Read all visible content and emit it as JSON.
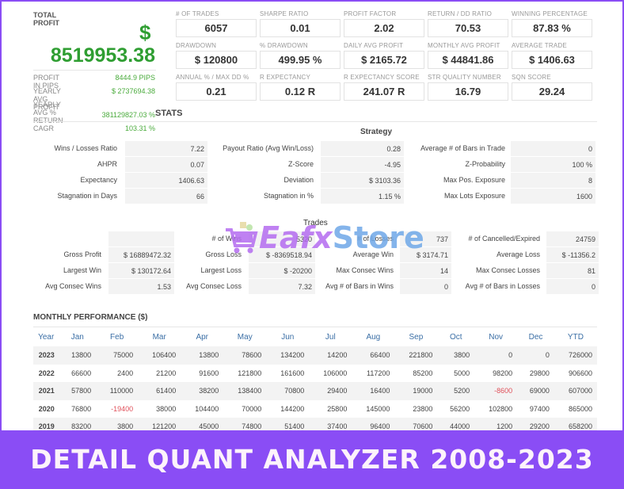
{
  "total_profit": {
    "label": "TOTAL PROFIT",
    "currency": "$",
    "value": "8519953.38"
  },
  "left_stats": [
    {
      "label": "PROFIT IN PIPS",
      "value": "8444.9 PIPS"
    },
    {
      "label": "YEARLY AVG PROFIT",
      "value": "$ 2737694.38"
    },
    {
      "label": "YEARLY AVG % RETURN",
      "value": "381129827.03 %"
    },
    {
      "label": "CAGR",
      "value": "103.31 %"
    }
  ],
  "metrics": [
    [
      {
        "label": "# OF TRADES",
        "value": "6057"
      },
      {
        "label": "SHARPE RATIO",
        "value": "0.01"
      },
      {
        "label": "PROFIT FACTOR",
        "value": "2.02"
      },
      {
        "label": "RETURN / DD RATIO",
        "value": "70.53"
      },
      {
        "label": "WINNING PERCENTAGE",
        "value": "87.83 %"
      }
    ],
    [
      {
        "label": "DRAWDOWN",
        "value": "$ 120800"
      },
      {
        "label": "% DRAWDOWN",
        "value": "499.95 %"
      },
      {
        "label": "DAILY AVG PROFIT",
        "value": "$ 2165.72"
      },
      {
        "label": "MONTHLY AVG PROFIT",
        "value": "$ 44841.86"
      },
      {
        "label": "AVERAGE TRADE",
        "value": "$ 1406.63"
      }
    ],
    [
      {
        "label": "ANNUAL % / MAX DD %",
        "value": "0.21"
      },
      {
        "label": "R EXPECTANCY",
        "value": "0.12 R"
      },
      {
        "label": "R EXPECTANCY SCORE",
        "value": "241.07 R"
      },
      {
        "label": "STR QUALITY NUMBER",
        "value": "16.79"
      },
      {
        "label": "SQN SCORE",
        "value": "29.24"
      }
    ]
  ],
  "stats_title": "STATS",
  "strategy": {
    "title": "Strategy",
    "rows": [
      [
        {
          "label": "Wins / Losses Ratio",
          "value": "7.22"
        },
        {
          "label": "Payout Ratio (Avg Win/Loss)",
          "value": "0.28"
        },
        {
          "label": "Average # of Bars in Trade",
          "value": "0"
        }
      ],
      [
        {
          "label": "AHPR",
          "value": "0.07"
        },
        {
          "label": "Z-Score",
          "value": "-4.95"
        },
        {
          "label": "Z-Probability",
          "value": "100 %"
        }
      ],
      [
        {
          "label": "Expectancy",
          "value": "1406.63"
        },
        {
          "label": "Deviation",
          "value": "$ 3103.36"
        },
        {
          "label": "Max Pos. Exposure",
          "value": "8"
        }
      ],
      [
        {
          "label": "Stagnation in Days",
          "value": "66"
        },
        {
          "label": "Stagnation in %",
          "value": "1.15 %"
        },
        {
          "label": "Max Lots Exposure",
          "value": "1600"
        }
      ]
    ]
  },
  "trades": {
    "title": "Trades",
    "rows": [
      [
        {
          "label": "",
          "value": ""
        },
        {
          "label": "# of Wins",
          "value": "5320"
        },
        {
          "label": "# of Losses",
          "value": "737"
        },
        {
          "label": "# of Cancelled/Expired",
          "value": "24759"
        }
      ],
      [
        {
          "label": "Gross Profit",
          "value": "$ 16889472.32"
        },
        {
          "label": "Gross Loss",
          "value": "$ -8369518.94"
        },
        {
          "label": "Average Win",
          "value": "$ 3174.71"
        },
        {
          "label": "Average Loss",
          "value": "$ -11356.2"
        }
      ],
      [
        {
          "label": "Largest Win",
          "value": "$ 130172.64"
        },
        {
          "label": "Largest Loss",
          "value": "$ -20200"
        },
        {
          "label": "Max Consec Wins",
          "value": "14"
        },
        {
          "label": "Max Consec Losses",
          "value": "81"
        }
      ],
      [
        {
          "label": "Avg Consec Wins",
          "value": "1.53"
        },
        {
          "label": "Avg Consec Loss",
          "value": "7.32"
        },
        {
          "label": "Avg # of Bars in Wins",
          "value": "0"
        },
        {
          "label": "Avg # of Bars in Losses",
          "value": "0"
        }
      ]
    ]
  },
  "monthly": {
    "title": "MONTHLY PERFORMANCE ($)",
    "headers": [
      "Year",
      "Jan",
      "Feb",
      "Mar",
      "Apr",
      "May",
      "Jun",
      "Jul",
      "Aug",
      "Sep",
      "Oct",
      "Nov",
      "Dec",
      "YTD"
    ],
    "rows": [
      [
        "2023",
        "13800",
        "75000",
        "106400",
        "13800",
        "78600",
        "134200",
        "14200",
        "66400",
        "221800",
        "3800",
        "0",
        "0",
        "726000"
      ],
      [
        "2022",
        "66600",
        "2400",
        "21200",
        "91600",
        "121800",
        "161600",
        "106000",
        "117200",
        "85200",
        "5000",
        "98200",
        "29800",
        "906600"
      ],
      [
        "2021",
        "57800",
        "110000",
        "61400",
        "38200",
        "138400",
        "70800",
        "29400",
        "16400",
        "19000",
        "5200",
        "-8600",
        "69000",
        "607000"
      ],
      [
        "2020",
        "76800",
        "-19400",
        "38000",
        "104400",
        "70000",
        "144200",
        "25800",
        "145000",
        "23800",
        "56200",
        "102800",
        "97400",
        "865000"
      ],
      [
        "2019",
        "83200",
        "3800",
        "121200",
        "45000",
        "74800",
        "51400",
        "37400",
        "96400",
        "70600",
        "44000",
        "1200",
        "29200",
        "658200"
      ]
    ],
    "negative_color": "#e0505a",
    "header_color": "#3a6ea5"
  },
  "watermark": {
    "part1": "Eafx",
    "part2": "Store"
  },
  "banner": "DETAIL QUANT ANALYZER 2008-2023",
  "colors": {
    "accent": "#8a4df5",
    "profit_green": "#2f9e32"
  }
}
